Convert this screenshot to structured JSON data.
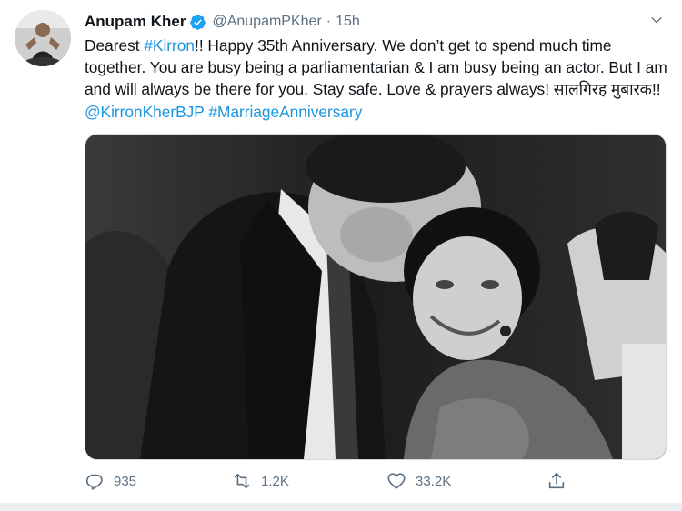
{
  "tweet": {
    "author_name": "Anupam Kher",
    "handle": "@AnupamPKher",
    "separator": "·",
    "time": "15h",
    "text_1": "Dearest ",
    "hashtag_1": "#Kirron",
    "text_2": "!! Happy 35th Anniversary. We don’t get to spend much time together. You are busy being a parliamentarian & I am busy being an actor. But I am and will always be there for you. Stay safe. Love & prayers always! सालगिरह मुबारक!! ",
    "mention_1": "@KirronKherBJP",
    "text_3": " ",
    "hashtag_2": "#MarriageAnniversary"
  },
  "actions": {
    "reply_count": "935",
    "retweet_count": "1.2K",
    "like_count": "33.2K"
  },
  "icons": {
    "verified": "verified-badge-icon",
    "caret": "chevron-down-icon",
    "reply": "reply-icon",
    "retweet": "retweet-icon",
    "like": "heart-icon",
    "share": "share-icon"
  },
  "colors": {
    "link": "#1b95e0",
    "secondary_text": "#5b7083",
    "verified": "#1da1f2"
  }
}
